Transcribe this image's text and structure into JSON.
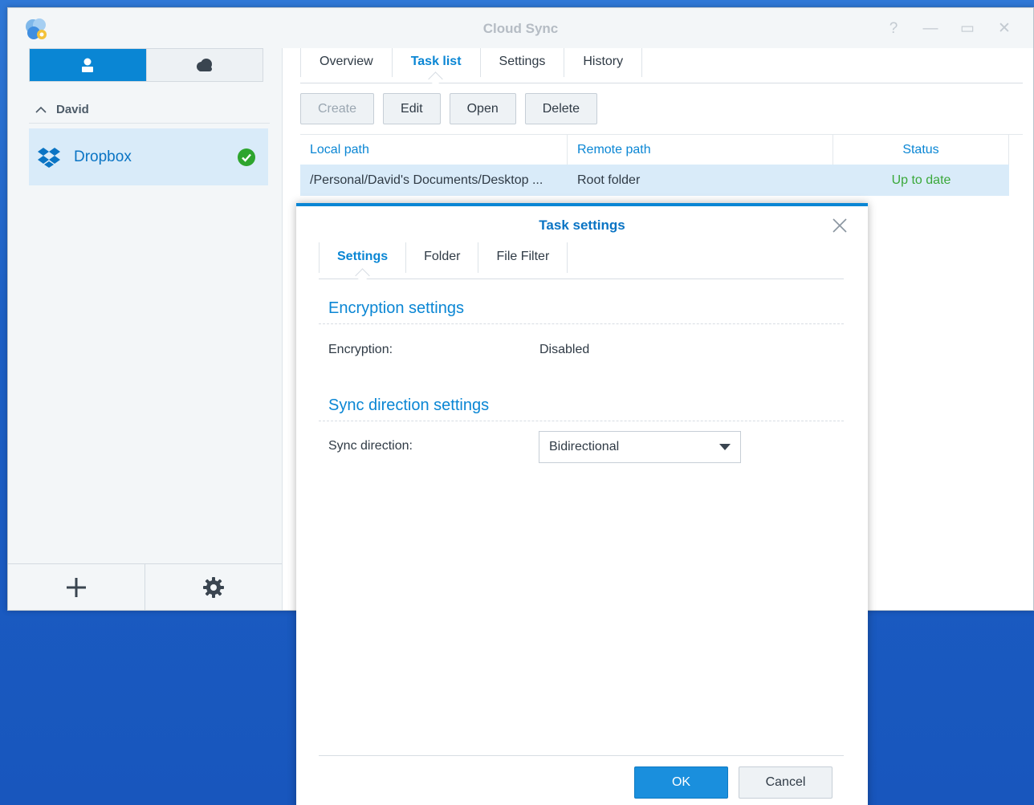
{
  "window": {
    "title": "Cloud Sync",
    "controls": [
      "help",
      "minimize",
      "maximize",
      "close"
    ]
  },
  "sidebar": {
    "segment": {
      "active": "user-icon",
      "inactive": "cloud-icon"
    },
    "group": {
      "label": "David"
    },
    "accounts": [
      {
        "label": "Dropbox",
        "icon": "dropbox-icon",
        "status": "ok"
      }
    ],
    "footer": {
      "add": "plus-icon",
      "settings": "gear-icon"
    }
  },
  "main": {
    "tabs": [
      {
        "label": "Overview",
        "active": false
      },
      {
        "label": "Task list",
        "active": true
      },
      {
        "label": "Settings",
        "active": false
      },
      {
        "label": "History",
        "active": false
      }
    ],
    "toolbar": {
      "create": "Create",
      "edit": "Edit",
      "open": "Open",
      "delete": "Delete"
    },
    "table": {
      "columns": [
        "Local path",
        "Remote path",
        "Status"
      ],
      "rows": [
        {
          "local": "/Personal/David's Documents/Desktop ...",
          "remote": "Root folder",
          "status": "Up to date"
        }
      ]
    }
  },
  "modal": {
    "title": "Task settings",
    "tabs": [
      {
        "label": "Settings",
        "active": true
      },
      {
        "label": "Folder",
        "active": false
      },
      {
        "label": "File Filter",
        "active": false
      }
    ],
    "encryption": {
      "section_title": "Encryption settings",
      "label": "Encryption:",
      "value": "Disabled"
    },
    "sync": {
      "section_title": "Sync direction settings",
      "label": "Sync direction:",
      "value": "Bidirectional"
    },
    "buttons": {
      "ok": "OK",
      "cancel": "Cancel"
    }
  },
  "colors": {
    "accent": "#0a86d4",
    "success": "#3aa83a",
    "selection": "#d9ebf9"
  }
}
